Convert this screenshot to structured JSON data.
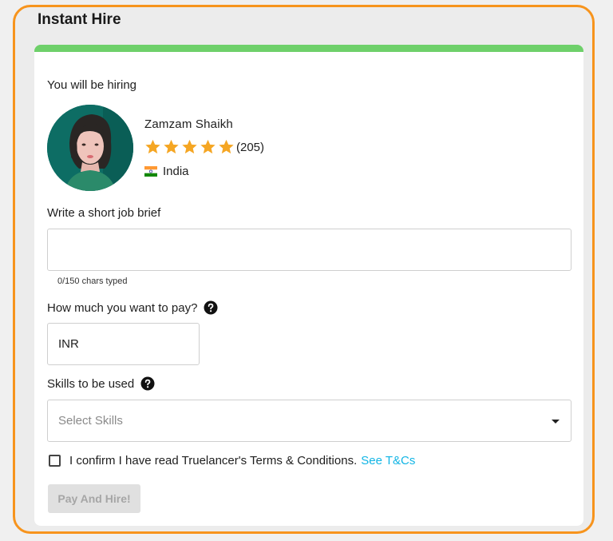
{
  "panel": {
    "title": "Instant Hire"
  },
  "card": {
    "hiring_label": "You will be hiring",
    "freelancer": {
      "name": "Zamzam Shaikh",
      "rating_stars": 5,
      "rating_count": "(205)",
      "country": "India"
    },
    "job_brief": {
      "label": "Write a short job brief",
      "value": "",
      "char_counter": "0/150 chars typed"
    },
    "payment": {
      "label": "How much you want to pay?",
      "currency": "INR"
    },
    "skills": {
      "label": "Skills to be used",
      "placeholder": "Select Skills"
    },
    "terms": {
      "text": "I confirm I have read Truelancer's Terms & Conditions.",
      "link": "See T&Cs",
      "checked": false
    },
    "submit_label": "Pay And Hire!"
  },
  "colors": {
    "frame_border": "#f7941d",
    "card_top_bar": "#6ed06a",
    "star": "#f5a623",
    "link": "#12b5e5"
  },
  "icons": [
    "star-icon",
    "india-flag-icon",
    "help-icon",
    "chevron-down-icon",
    "checkbox-icon"
  ]
}
